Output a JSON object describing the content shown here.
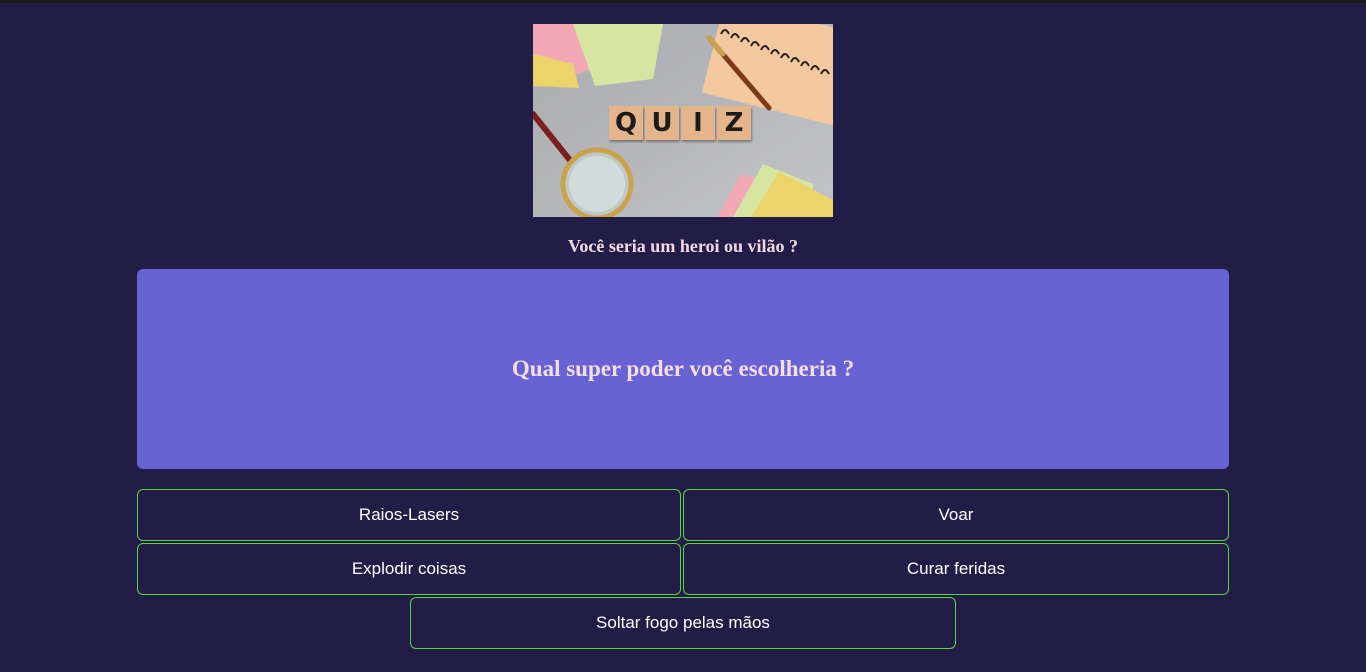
{
  "quiz_image": {
    "letters": [
      "Q",
      "U",
      "I",
      "Z"
    ]
  },
  "subtitle": "Você seria um heroi ou vilão ?",
  "question": "Qual super poder você escolheria ?",
  "answers": [
    "Raios-Lasers",
    "Voar",
    "Explodir coisas",
    "Curar feridas",
    "Soltar fogo pelas mãos"
  ],
  "colors": {
    "background": "#221d47",
    "card": "#6763d3",
    "answer_border": "#5fd046",
    "heading_text": "#f3d9e4"
  }
}
